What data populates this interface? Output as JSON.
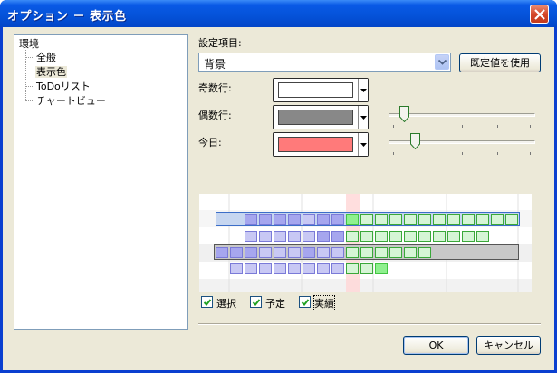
{
  "window": {
    "title": "オプション － 表示色"
  },
  "tree": {
    "root": "環境",
    "children": [
      "全般",
      "表示色",
      "ToDoリスト",
      "チャートビュー"
    ],
    "selected": "表示色"
  },
  "settings": {
    "item_label": "設定項目:",
    "item_value": "背景",
    "default_button": "既定値を使用"
  },
  "colors": {
    "odd_label": "奇数行:",
    "even_label": "偶数行:",
    "today_label": "今日:",
    "odd_color": "#ffffff",
    "even_color": "#888888",
    "today_color": "#ff7a7a"
  },
  "sliders": {
    "even_level": 0.08,
    "today_level": 0.16
  },
  "preview": {
    "accent_blue": "#7a7ad8",
    "accent_green": "#3aa83a"
  },
  "checks": [
    {
      "label": "選択",
      "checked": true
    },
    {
      "label": "予定",
      "checked": true
    },
    {
      "label": "実績",
      "checked": true
    }
  ],
  "footer": {
    "ok": "OK",
    "cancel": "キャンセル"
  }
}
